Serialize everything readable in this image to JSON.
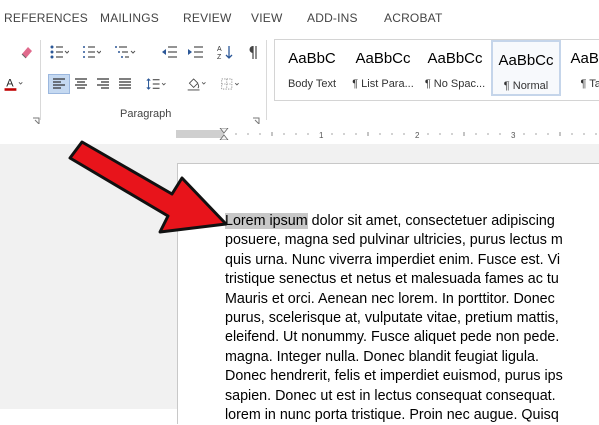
{
  "tabs": [
    "REFERENCES",
    "MAILINGS",
    "REVIEW",
    "VIEW",
    "ADD-INS",
    "ACROBAT"
  ],
  "ribbon": {
    "group_label": "Paragraph",
    "icons": [
      "clear-formatting-icon",
      "font-color-icon",
      "bullets-icon",
      "numbering-icon",
      "multilevel-list-icon",
      "decrease-indent-icon",
      "increase-indent-icon",
      "sort-icon",
      "show-marks-icon",
      "align-left-icon",
      "align-center-icon",
      "align-right-icon",
      "justify-icon",
      "line-spacing-icon",
      "shading-icon",
      "borders-icon"
    ],
    "styles": [
      {
        "sample": "AaBbC",
        "name": "Body Text"
      },
      {
        "sample": "AaBbCc",
        "name": "¶ List Para..."
      },
      {
        "sample": "AaBbCc",
        "name": "¶ No Spac..."
      },
      {
        "sample": "AaBbCc",
        "name": "¶ Normal",
        "selected": true
      },
      {
        "sample": "AaBbCc",
        "name": "¶ Table"
      }
    ]
  },
  "ruler": {
    "labels": [
      "1",
      "2",
      "3"
    ]
  },
  "document": {
    "highlight": "Lorem ipsum",
    "first_line_rest": " dolor sit amet, consectetuer adipiscing",
    "lines": [
      "posuere, magna sed pulvinar ultricies, purus lectus m",
      "quis urna. Nunc viverra imperdiet enim. Fusce est. Vi",
      "tristique senectus et netus et malesuada fames ac tu",
      "Mauris et orci. Aenean nec lorem. In porttitor. Donec",
      "purus, scelerisque at, vulputate vitae, pretium mattis,",
      "eleifend. Ut nonummy. Fusce aliquet pede non pede.",
      "magna. Integer nulla. Donec blandit feugiat ligula.",
      "Donec hendrerit, felis et imperdiet euismod, purus ips",
      "sapien. Donec ut est in lectus consequat consequat.",
      "lorem in nunc porta tristique. Proin nec augue. Quisq"
    ]
  },
  "colors": {
    "accent_arrow": "#e8141b",
    "font_color_bar": "#c00000",
    "selected_style_border": "#c5d5ea"
  }
}
